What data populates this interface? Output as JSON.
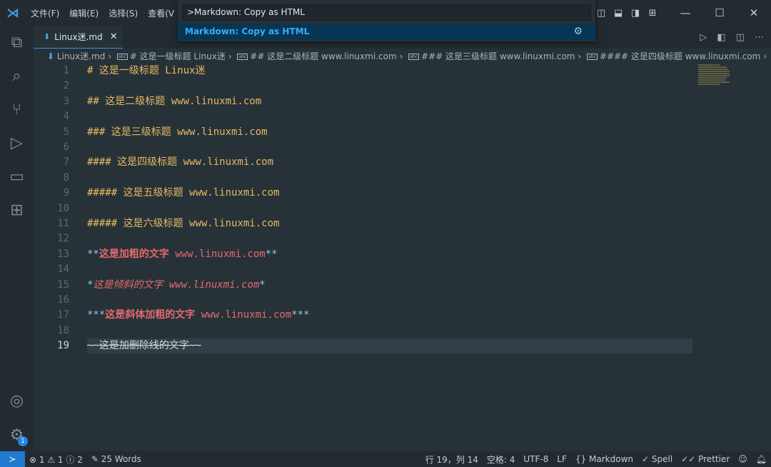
{
  "titlebar": {
    "menus": [
      "文件(F)",
      "编辑(E)",
      "选择(S)",
      "查看(V"
    ]
  },
  "palette": {
    "input": ">Markdown: Copy as HTML",
    "item": "Markdown: Copy as HTML"
  },
  "tab": {
    "label": "Linux迷.md"
  },
  "breadcrumb": [
    "Linux迷.md",
    "# 这是一级标题 Linux迷",
    "## 这是二级标题 www.linuxmi.com",
    "### 这是三级标题 www.linuxmi.com",
    "#### 这是四级标题 www.linuxmi.com"
  ],
  "lines": {
    "l1": {
      "mark": "#",
      "text": " 这是一级标题 Linux迷"
    },
    "l3": {
      "mark": "##",
      "text": " 这是二级标题 www.linuxmi.com"
    },
    "l5": {
      "mark": "###",
      "text": " 这是三级标题 www.linuxmi.com"
    },
    "l7": {
      "mark": "####",
      "text": " 这是四级标题 www.linuxmi.com"
    },
    "l9": {
      "mark": "#####",
      "text": " 这是五级标题 www.linuxmi.com"
    },
    "l11": {
      "mark": "#####",
      "text": " 这是六级标题 www.linuxmi.com"
    },
    "l13": {
      "open": "**",
      "bold": "这是加粗的文字",
      "rest": " www.linuxmi.com",
      "close": "**"
    },
    "l15": {
      "open": "*",
      "text": "这是倾斜的文字 www.linuxmi.com",
      "close": "*"
    },
    "l17": {
      "open": "***",
      "bold": "这是斜体加粗的文字",
      "rest": " www.linuxmi.com",
      "close": "***"
    },
    "l19": {
      "open": "~~",
      "text": "这是加删除线的文字",
      "close": "~~"
    }
  },
  "line_numbers": [
    "1",
    "2",
    "3",
    "4",
    "5",
    "6",
    "7",
    "8",
    "9",
    "10",
    "11",
    "12",
    "13",
    "14",
    "15",
    "16",
    "17",
    "18",
    "19"
  ],
  "status": {
    "errors": "1",
    "warnings": "1",
    "info": "2",
    "words": "25 Words",
    "position": "行 19，列 14",
    "spaces": "空格: 4",
    "encoding": "UTF-8",
    "eol": "LF",
    "language": "Markdown",
    "spell": "Spell",
    "prettier": "Prettier"
  },
  "settings_badge": "1",
  "colors": {
    "accent": "#1f7ad0",
    "heading": "#e7b863",
    "bold": "#e46a6f",
    "punct": "#8fc9e8"
  }
}
